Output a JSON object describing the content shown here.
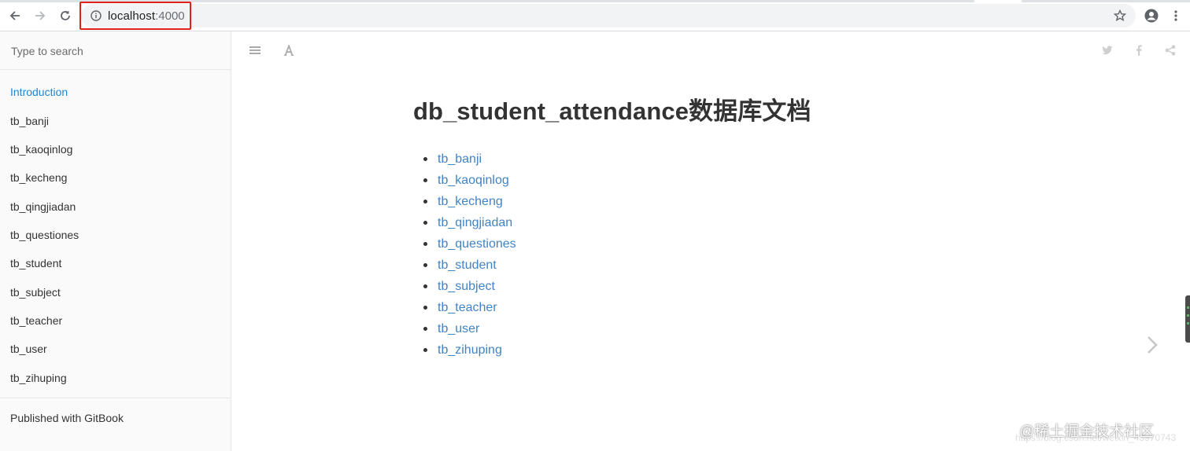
{
  "browser": {
    "url_host": "localhost",
    "url_port": ":4000",
    "icons": [
      "back-icon",
      "forward-icon",
      "reload-icon",
      "info-icon",
      "star-icon",
      "profile-icon",
      "menu-icon"
    ]
  },
  "sidebar": {
    "search_placeholder": "Type to search",
    "items": [
      {
        "label": "Introduction",
        "active": true
      },
      {
        "label": "tb_banji"
      },
      {
        "label": "tb_kaoqinlog"
      },
      {
        "label": "tb_kecheng"
      },
      {
        "label": "tb_qingjiadan"
      },
      {
        "label": "tb_questiones"
      },
      {
        "label": "tb_student"
      },
      {
        "label": "tb_subject"
      },
      {
        "label": "tb_teacher"
      },
      {
        "label": "tb_user"
      },
      {
        "label": "tb_zihuping"
      }
    ],
    "published": "Published with GitBook"
  },
  "header_icons": [
    "toc-toggle-icon",
    "font-settings-icon",
    "twitter-icon",
    "facebook-icon",
    "share-icon"
  ],
  "main": {
    "title": "db_student_attendance数据库文档",
    "toc_links": [
      "tb_banji",
      "tb_kaoqinlog",
      "tb_kecheng",
      "tb_qingjiadan",
      "tb_questiones",
      "tb_student",
      "tb_subject",
      "tb_teacher",
      "tb_user",
      "tb_zihuping"
    ]
  },
  "watermark": {
    "text": "@稀土掘金技术社区",
    "url": "https://blog.csdn.net/weixin_43970743"
  },
  "colors": {
    "link": "#4183c4",
    "active_nav": "#1c86d6",
    "url_highlight": "#e0201b"
  }
}
